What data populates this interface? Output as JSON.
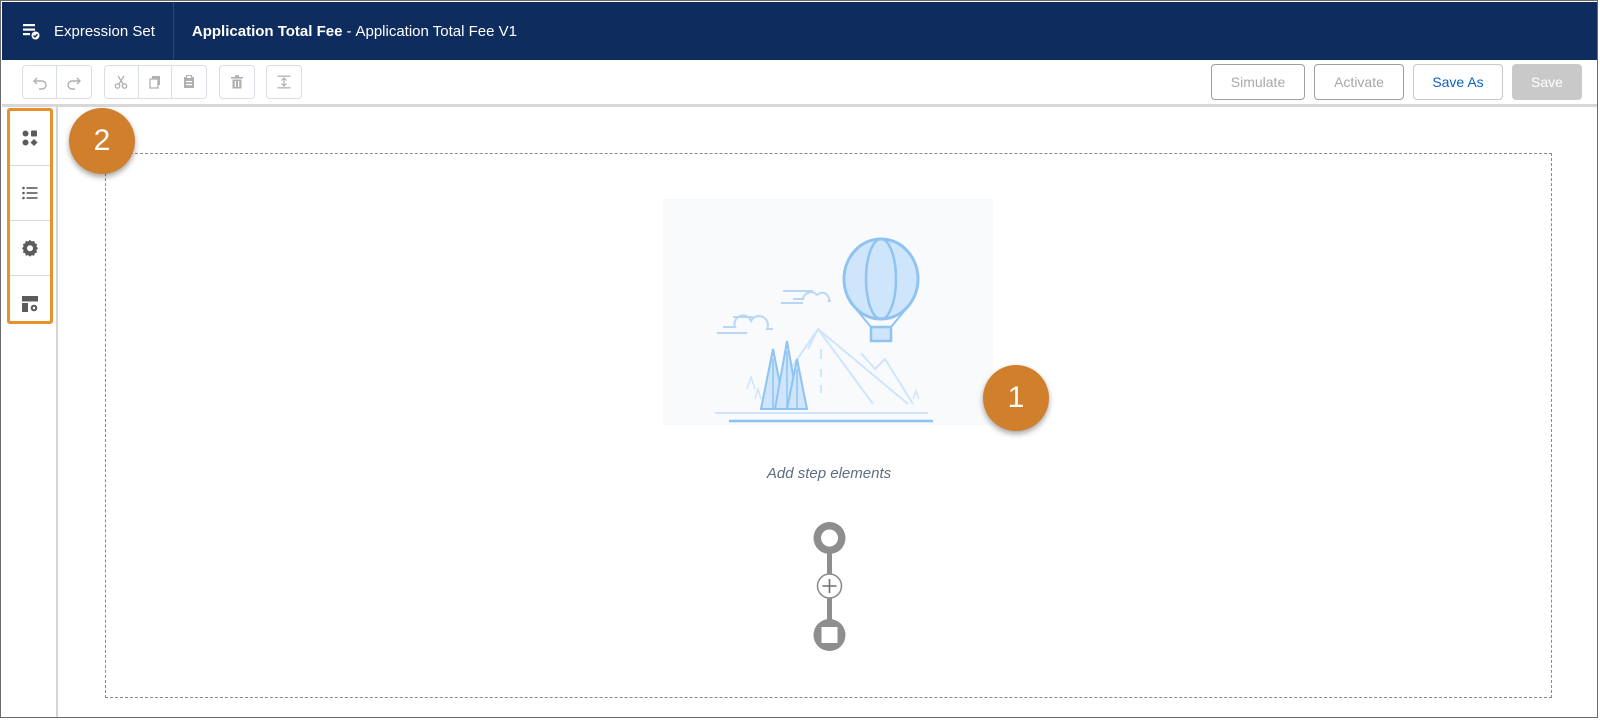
{
  "header": {
    "app_icon": "expression-set-icon",
    "app_label": "Expression Set",
    "title_bold": "Application Total Fee",
    "title_sep": "-",
    "title_rest": "Application Total Fee V1",
    "bg_color": "#0e2d5e"
  },
  "toolbar": {
    "icons": [
      "undo-icon",
      "redo-icon",
      "cut-icon",
      "copy-icon",
      "paste-icon",
      "delete-icon",
      "align-icon"
    ],
    "buttons": {
      "simulate": "Simulate",
      "activate": "Activate",
      "save_as": "Save As",
      "save": "Save"
    }
  },
  "left_rail": {
    "items": [
      "elements-icon",
      "list-icon",
      "settings-gear-icon",
      "layout-settings-icon"
    ],
    "highlight_color": "#e8912a"
  },
  "canvas": {
    "empty_text": "Add step elements",
    "illustration": "hot-air-balloon-mountains"
  },
  "callouts": {
    "one": "1",
    "two": "2",
    "color": "#d0802d"
  }
}
